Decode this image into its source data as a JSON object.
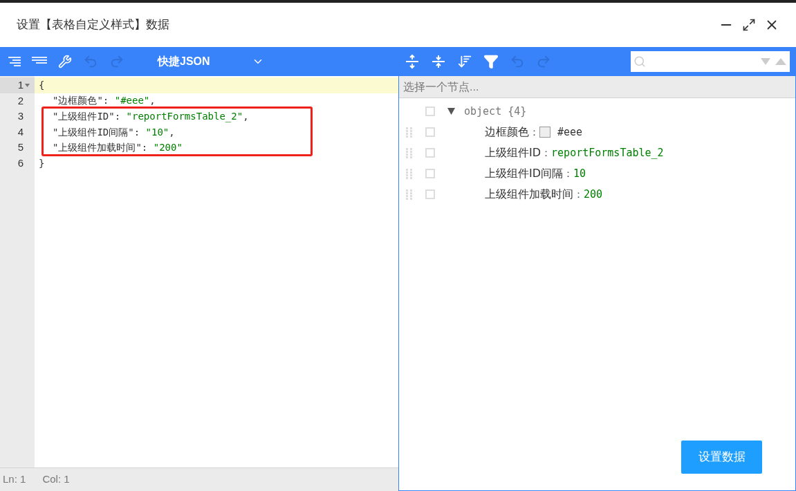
{
  "window": {
    "title": "设置【表格自定义样式】数据"
  },
  "code_editor": {
    "mode_label": "快捷JSON",
    "lines": [
      {
        "number": "1",
        "selected": true,
        "foldable": true,
        "segments": [
          {
            "kind": "punct",
            "text": "{"
          }
        ]
      },
      {
        "number": "2",
        "selected": false,
        "foldable": false,
        "segments": [
          {
            "kind": "key",
            "text": "\"边框颜色\""
          },
          {
            "kind": "punct",
            "text": ": "
          },
          {
            "kind": "string",
            "text": "\"#eee\""
          },
          {
            "kind": "punct",
            "text": ","
          }
        ]
      },
      {
        "number": "3",
        "selected": false,
        "foldable": false,
        "segments": [
          {
            "kind": "key",
            "text": "\"上级组件ID\""
          },
          {
            "kind": "punct",
            "text": ": "
          },
          {
            "kind": "string",
            "text": "\"reportFormsTable_2\""
          },
          {
            "kind": "punct",
            "text": ","
          }
        ]
      },
      {
        "number": "4",
        "selected": false,
        "foldable": false,
        "segments": [
          {
            "kind": "key",
            "text": "\"上级组件ID间隔\""
          },
          {
            "kind": "punct",
            "text": ": "
          },
          {
            "kind": "string",
            "text": "\"10\""
          },
          {
            "kind": "punct",
            "text": ","
          }
        ]
      },
      {
        "number": "5",
        "selected": false,
        "foldable": false,
        "segments": [
          {
            "kind": "key",
            "text": "\"上级组件加载时间\""
          },
          {
            "kind": "punct",
            "text": ": "
          },
          {
            "kind": "string",
            "text": "\"200\""
          }
        ]
      },
      {
        "number": "6",
        "selected": false,
        "foldable": false,
        "segments": [
          {
            "kind": "punct",
            "text": "}"
          }
        ]
      }
    ],
    "status_bar": {
      "line": "Ln: 1",
      "column": "Col: 1"
    }
  },
  "tree_editor": {
    "breadcrumb_placeholder": "选择一个节点...",
    "root": {
      "label": "object {4}",
      "expanded": true,
      "children": [
        {
          "key": "边框颜色",
          "separator": "：",
          "kind": "color",
          "value": "#eee",
          "color": "#eeeeee"
        },
        {
          "key": "上级组件ID",
          "separator": "：",
          "kind": "text",
          "value": "reportFormsTable_2"
        },
        {
          "key": "上级组件ID间隔",
          "separator": "：",
          "kind": "text",
          "value": "10"
        },
        {
          "key": "上级组件加载时间",
          "separator": "：",
          "kind": "text",
          "value": "200"
        }
      ]
    }
  },
  "buttons": [
    {
      "label": "设置数据"
    }
  ]
}
